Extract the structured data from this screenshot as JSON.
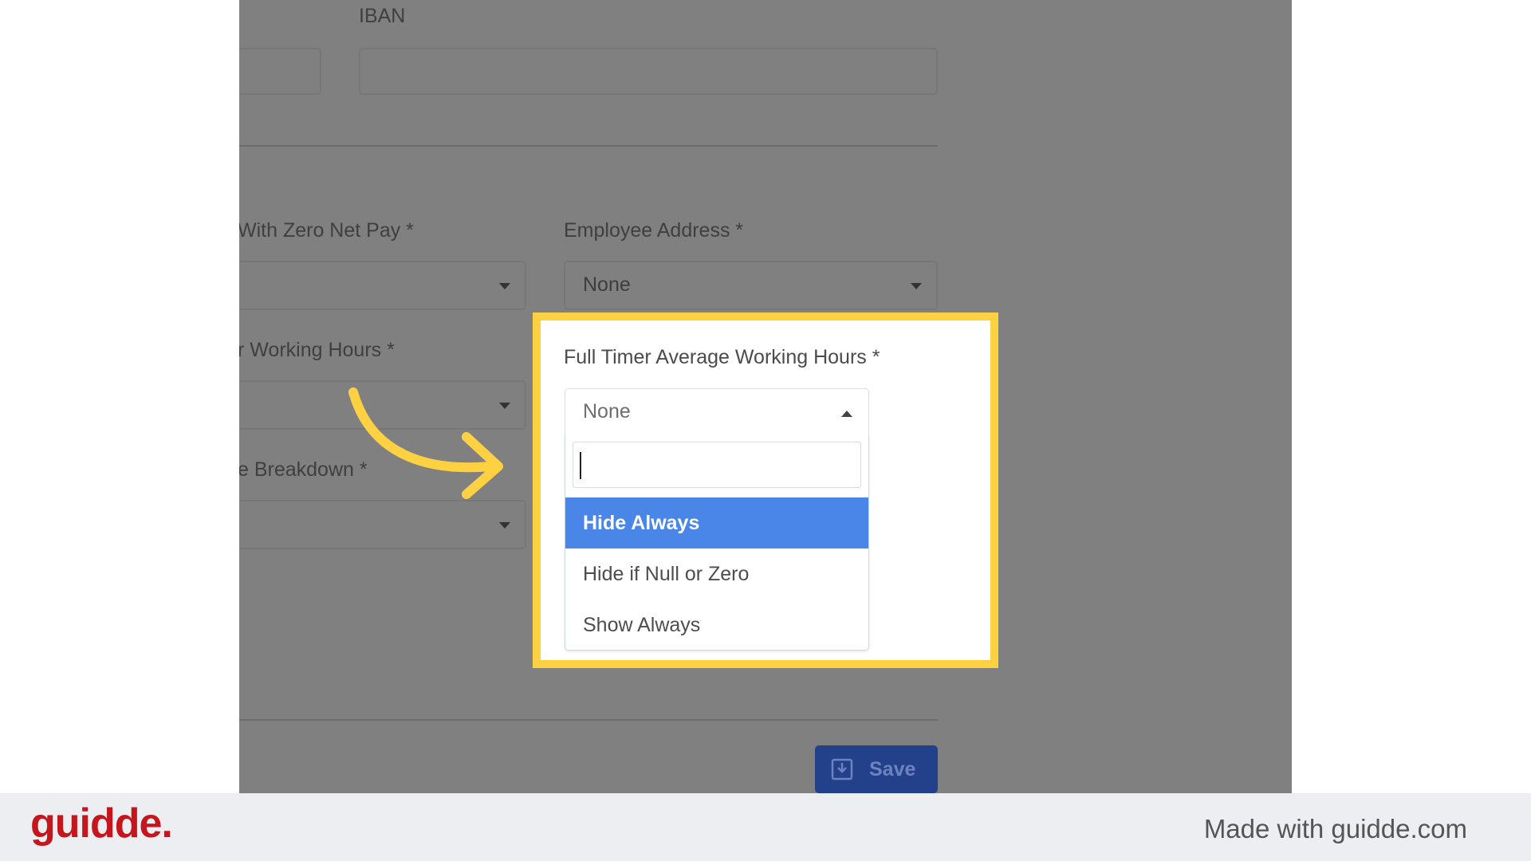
{
  "form": {
    "iban_label": "IBAN",
    "zero_net_pay_label": "With Zero Net Pay *",
    "employee_address_label": "Employee Address *",
    "employee_address_value": "None",
    "working_hours_label": "r Working Hours *",
    "breakdown_label": "e Breakdown *",
    "save_label": "Save"
  },
  "highlight": {
    "label": "Full Timer Average Working Hours  *",
    "selected_value": "None",
    "search_value": "",
    "options": [
      "Hide Always",
      "Hide if Null or Zero",
      "Show Always"
    ],
    "active_index": 0
  },
  "footer": {
    "logo_text": "guidde.",
    "credit_text": "Made with guidde.com"
  },
  "colors": {
    "highlight_border": "#fdd142",
    "option_active": "#4a86e8",
    "save_button": "#23408a",
    "logo": "#c4161c",
    "arrow": "#fdd142"
  }
}
